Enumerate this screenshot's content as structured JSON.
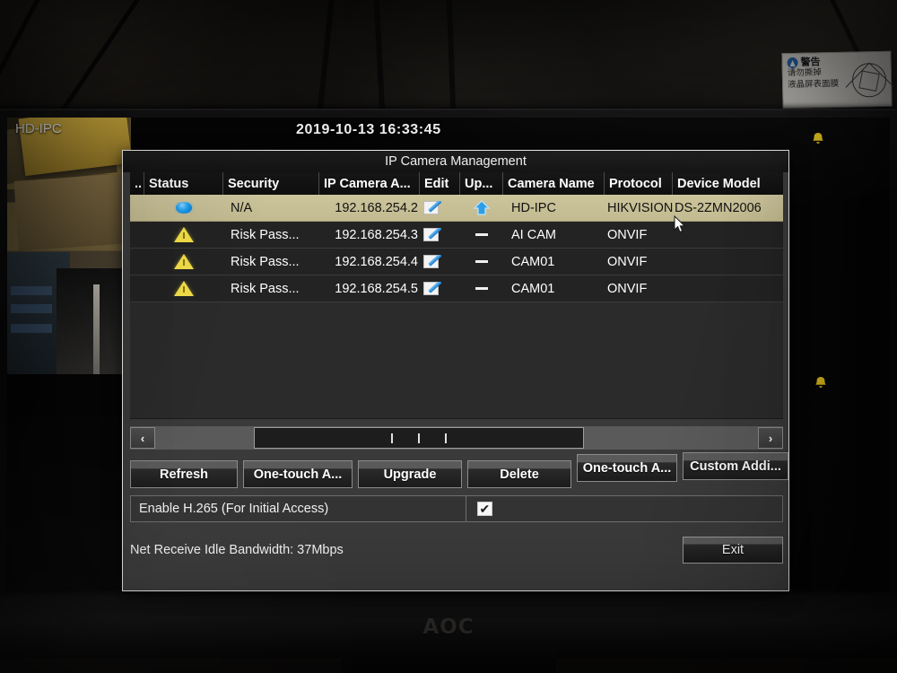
{
  "photo": {
    "monitor_brand": "AOC",
    "sticker": {
      "title": "警告",
      "line1": "请勿撕掉",
      "line2": "液晶屏表面膜"
    }
  },
  "screen": {
    "live_view": {
      "channel_label": "HD-IPC"
    },
    "clock": "2019-10-13  16:33:45"
  },
  "dialog": {
    "title": "IP Camera Management",
    "columns": [
      {
        "key": "chk",
        "label": ".."
      },
      {
        "key": "status",
        "label": "Status"
      },
      {
        "key": "security",
        "label": "Security"
      },
      {
        "key": "ip",
        "label": "IP Camera A..."
      },
      {
        "key": "edit",
        "label": "Edit"
      },
      {
        "key": "upgrade",
        "label": "Up..."
      },
      {
        "key": "name",
        "label": "Camera Name"
      },
      {
        "key": "protocol",
        "label": "Protocol"
      },
      {
        "key": "model",
        "label": "Device Model"
      }
    ],
    "rows": [
      {
        "selected": true,
        "status_icon": "blue-circle-icon",
        "security": "N/A",
        "ip": "192.168.254.2",
        "edit_icon": "pencil-edit-icon",
        "upgrade_icon": "blue-up-arrow-icon",
        "name": "HD-IPC",
        "protocol": "HIKVISION",
        "model": "DS-2ZMN2006"
      },
      {
        "selected": false,
        "status_icon": "yellow-warning-triangle-icon",
        "security": "Risk Pass...",
        "ip": "192.168.254.3",
        "edit_icon": "pencil-edit-icon",
        "upgrade_icon": "dash-icon",
        "name": "AI CAM",
        "protocol": "ONVIF",
        "model": ""
      },
      {
        "selected": false,
        "status_icon": "yellow-warning-triangle-icon",
        "security": "Risk Pass...",
        "ip": "192.168.254.4",
        "edit_icon": "pencil-edit-icon",
        "upgrade_icon": "dash-icon",
        "name": "CAM01",
        "protocol": "ONVIF",
        "model": ""
      },
      {
        "selected": false,
        "status_icon": "yellow-warning-triangle-icon",
        "security": "Risk Pass...",
        "ip": "192.168.254.5",
        "edit_icon": "pencil-edit-icon",
        "upgrade_icon": "dash-icon",
        "name": "CAM01",
        "protocol": "ONVIF",
        "model": ""
      }
    ],
    "scrollbar": {
      "left_arrow": "‹",
      "right_arrow": "›"
    },
    "buttons": [
      {
        "key": "refresh",
        "label": "Refresh"
      },
      {
        "key": "one_touch_activate",
        "label": "One-touch A..."
      },
      {
        "key": "upgrade",
        "label": "Upgrade"
      },
      {
        "key": "delete",
        "label": "Delete"
      },
      {
        "key": "one_touch_add",
        "label": "One-touch A..."
      },
      {
        "key": "custom_adding",
        "label": "Custom Addi..."
      }
    ],
    "option": {
      "label": "Enable H.265 (For Initial Access)",
      "checked": true,
      "check_glyph": "✔"
    },
    "bandwidth": "Net Receive Idle Bandwidth: 37Mbps",
    "exit_label": "Exit"
  },
  "colors": {
    "selected_row": "#c8c096",
    "dialog_bg": "#3a3a3a",
    "header_bg": "#141414",
    "status_ok": "#22a3f0",
    "status_risk": "#f5e04a",
    "text": "#ffffff"
  }
}
